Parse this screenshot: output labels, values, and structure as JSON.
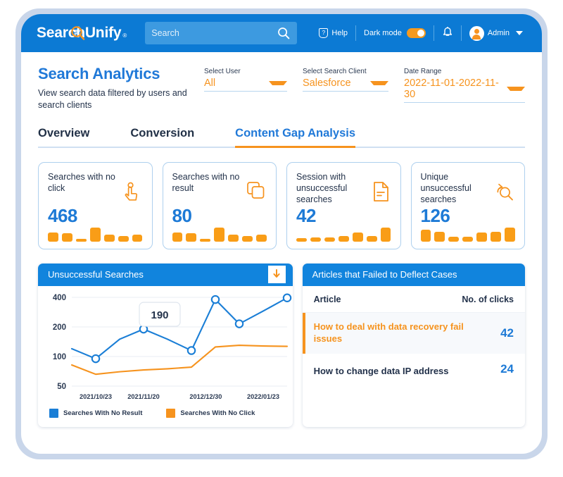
{
  "brand": {
    "name": "SearchUnify",
    "trademark": "®"
  },
  "topbar": {
    "search_placeholder": "Search",
    "help_label": "Help",
    "dark_mode_label": "Dark mode",
    "user_label": "Admin"
  },
  "header": {
    "title": "Search Analytics",
    "subtitle": "View search data filtered by users and search clients"
  },
  "filters": [
    {
      "label": "Select User",
      "value": "All"
    },
    {
      "label": "Select Search Client",
      "value": "Salesforce"
    },
    {
      "label": "Date Range",
      "value": "2022-11-01-2022-11-30"
    }
  ],
  "tabs": [
    {
      "label": "Overview",
      "active": false
    },
    {
      "label": "Conversion",
      "active": false
    },
    {
      "label": "Content Gap Analysis",
      "active": true
    }
  ],
  "cards": [
    {
      "title": "Searches with no click",
      "value": "468",
      "icon": "tap-click-icon",
      "spark": [
        12,
        11,
        4,
        18,
        9,
        7,
        9
      ]
    },
    {
      "title": "Searches with no result",
      "value": "80",
      "icon": "copy-pages-icon",
      "spark": [
        12,
        11,
        4,
        18,
        9,
        7,
        9
      ]
    },
    {
      "title": "Session with unsuccessful searches",
      "value": "42",
      "icon": "document-icon",
      "spark": [
        4,
        5,
        5,
        6,
        10,
        6,
        16
      ]
    },
    {
      "title": "Unique unsuccessful searches",
      "value": "126",
      "icon": "search-back-icon",
      "spark": [
        12,
        10,
        5,
        5,
        9,
        10,
        14
      ]
    }
  ],
  "chart_panel": {
    "title": "Unsuccessful Searches",
    "download_icon": "download-arrow-icon"
  },
  "chart_data": {
    "type": "line",
    "title": "Unsuccessful Searches",
    "xlabel": "",
    "ylabel": "",
    "yticks": [
      400,
      200,
      100,
      50
    ],
    "ylim": [
      50,
      400
    ],
    "yscale": "log",
    "grid": true,
    "legend_position": "bottom-left",
    "tooltip": {
      "value": "190",
      "series": "Searches With No Result",
      "x_index": 3
    },
    "xticks": [
      "2021/10/23",
      "2021/11/20",
      "2012/12/30",
      "2022/01/23"
    ],
    "x": [
      "2021/10/23",
      "",
      "2021/11/20",
      "",
      "2012/12/30",
      "",
      "2022/01/23",
      ""
    ],
    "series": [
      {
        "name": "Searches With No Result",
        "color": "#1a7ed6",
        "values": [
          120,
          95,
          150,
          190,
          150,
          115,
          380,
          215,
          290,
          395
        ],
        "markers": [
          false,
          true,
          false,
          true,
          false,
          true,
          true,
          true,
          false,
          true
        ]
      },
      {
        "name": "Searches With No Click",
        "color": "#f6931e",
        "values": [
          82,
          66,
          70,
          73,
          75,
          78,
          125,
          130,
          128,
          127
        ],
        "markers": [
          false,
          false,
          false,
          false,
          false,
          false,
          false,
          false,
          false,
          false
        ]
      }
    ]
  },
  "table_panel": {
    "title": "Articles that Failed to Deflect Cases",
    "columns": [
      "Article",
      "No. of clicks"
    ],
    "rows": [
      {
        "article": "How to deal with data recovery fail issues",
        "clicks": "42",
        "highlighted": true
      },
      {
        "article": "How to change data IP address",
        "clicks": "24",
        "highlighted": false
      }
    ]
  },
  "colors": {
    "brand_blue": "#0c7ad4",
    "accent_orange": "#f6931e",
    "value_blue": "#1d7ad6",
    "bezel": "#c9d6ea"
  }
}
